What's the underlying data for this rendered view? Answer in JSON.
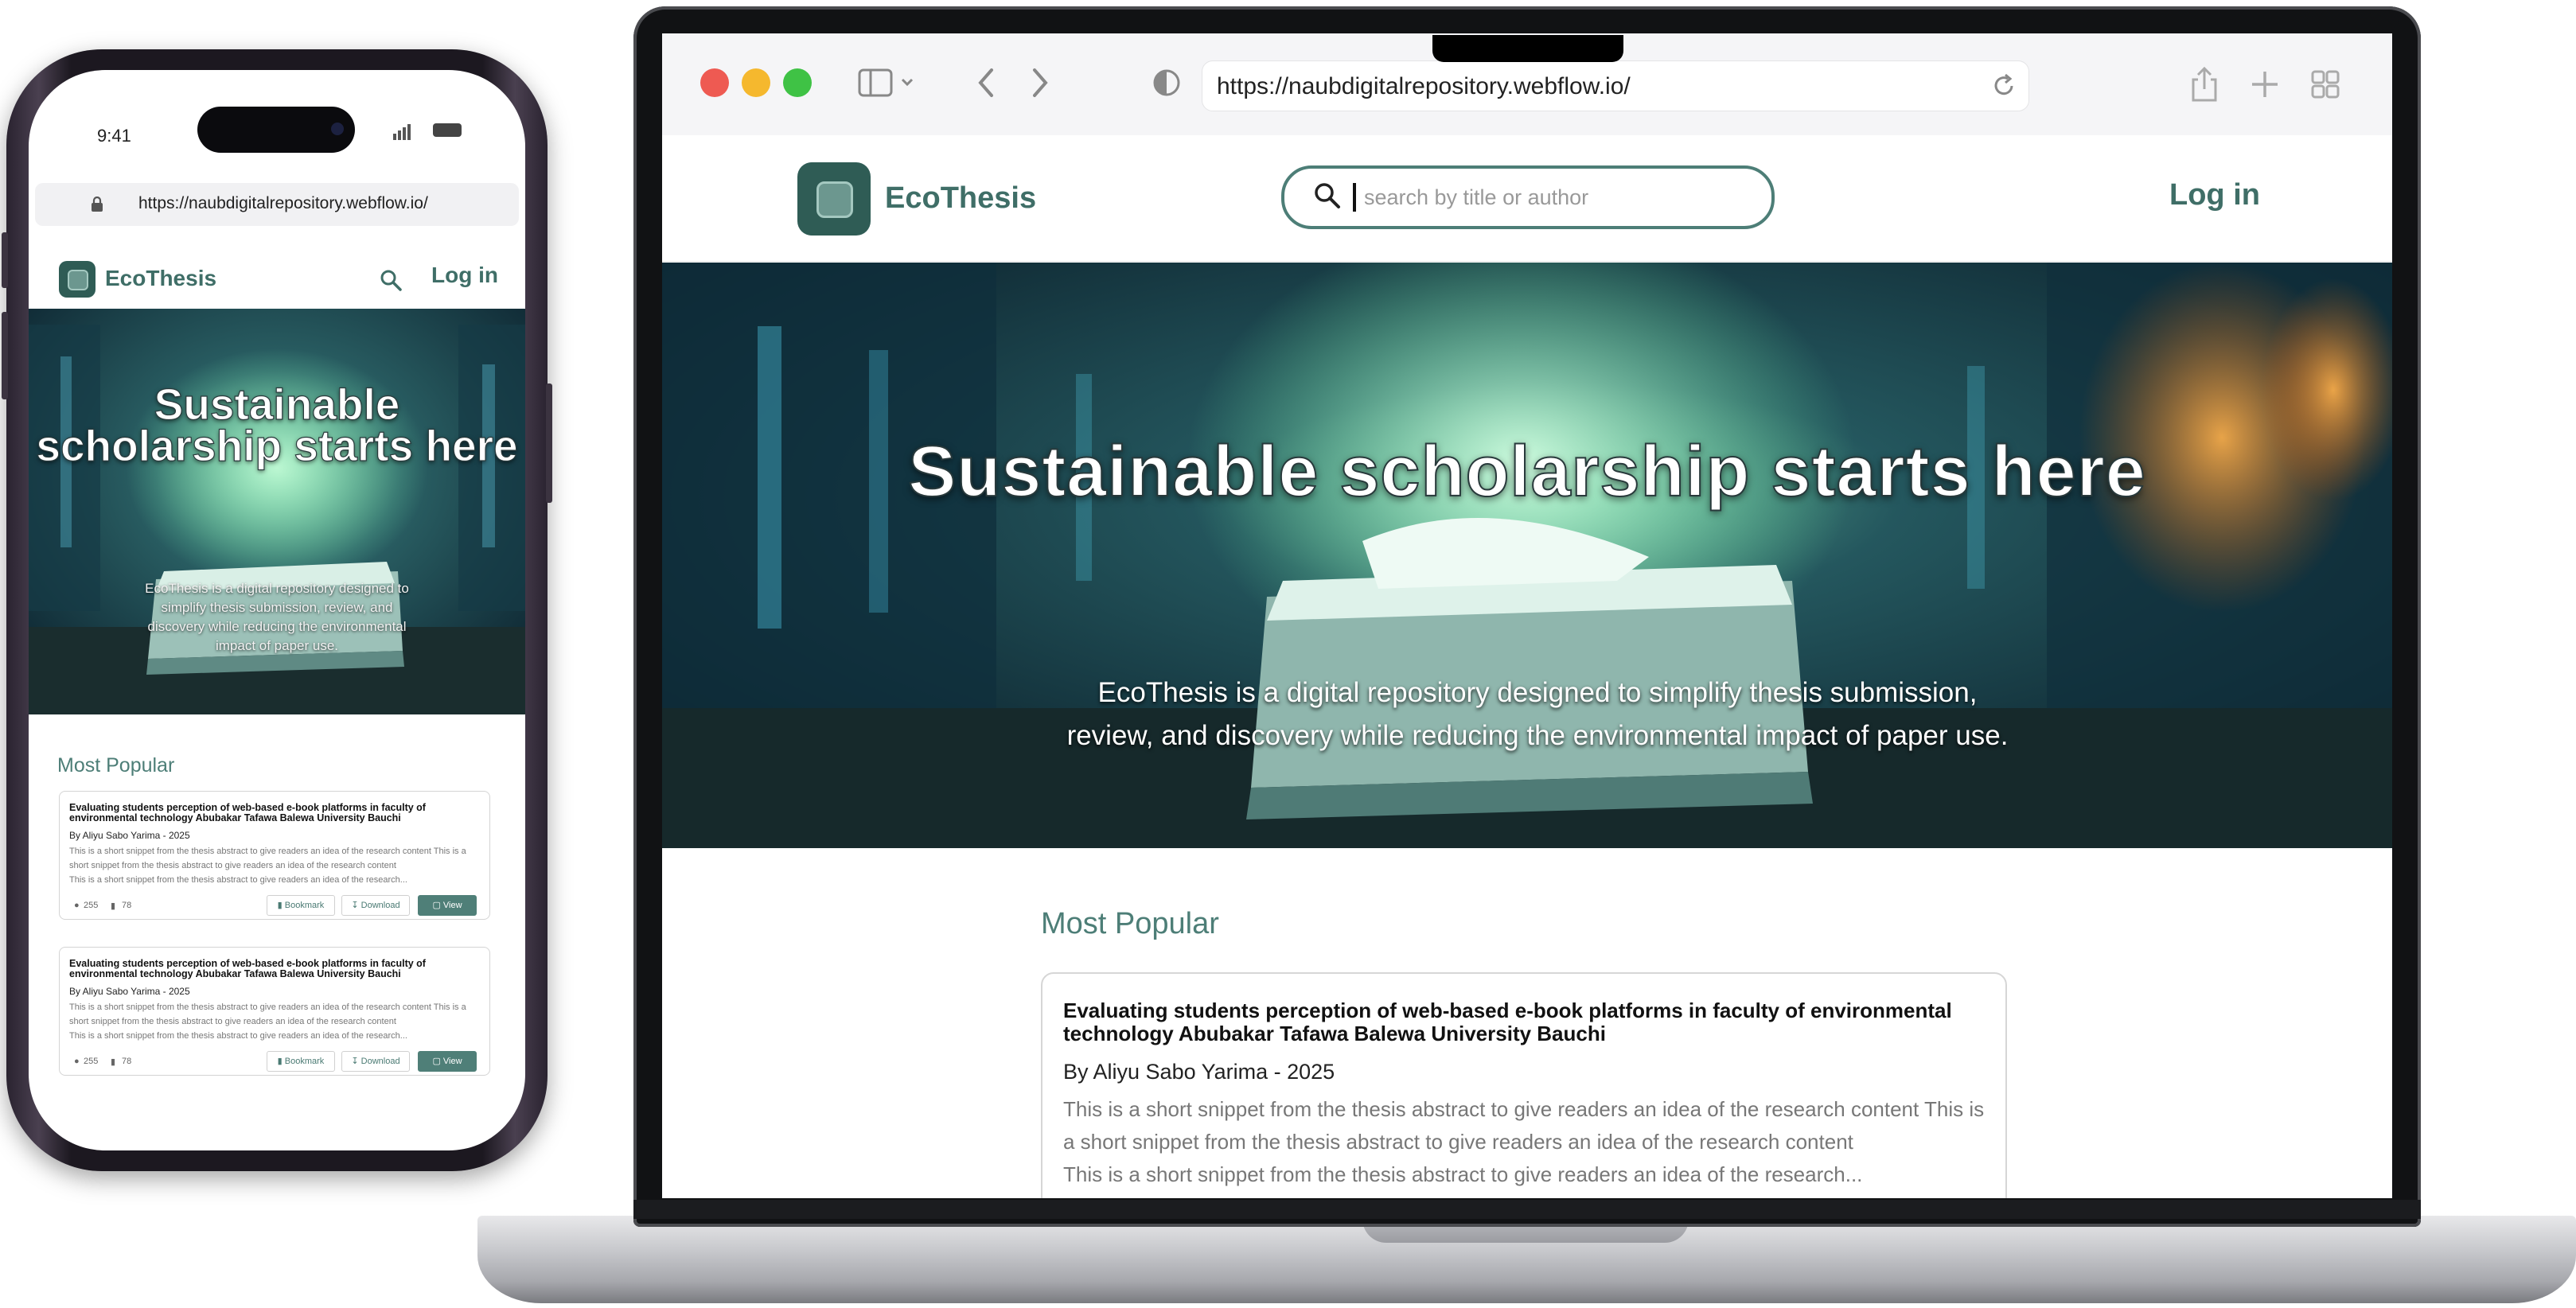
{
  "browser": {
    "url": "https://naubdigitalrepository.webflow.io/"
  },
  "phone": {
    "status_time": "9:41",
    "url": "https://naubdigitalrepository.webflow.io/"
  },
  "site": {
    "brand": "EcoThesis",
    "login_label": "Log in",
    "search_placeholder": "search by title or author",
    "hero_title": "Sustainable scholarship starts here",
    "hero_description": "EcoThesis is a digital repository designed to simplify thesis submission, review, and discovery while reducing the environmental impact of paper use.",
    "section_title": "Most Popular",
    "accent_color": "#4d7e77",
    "brand_color": "#2f5c55"
  },
  "theses": [
    {
      "title": "Evaluating students perception of web-based e-book platforms in faculty of environmental technology Abubakar Tafawa Balewa University Bauchi",
      "author_line": "By Aliyu Sabo Yarima  - 2025",
      "snippet": "This is a short snippet from the thesis abstract to give readers  an idea of the research content This is a short snippet from the thesis abstract to give readers  an idea of the research content",
      "snippet_2": "This is a short snippet from the thesis abstract to give readers an idea of the research...",
      "views": "255",
      "bookmarks": "78",
      "bookmark_label": "Bookmark",
      "download_label": "Download",
      "view_label": "View"
    },
    {
      "title": "Evaluating students perception of web-based e-book platforms in faculty of environmental technology Abubakar Tafawa Balewa University Bauchi",
      "author_line": "By Aliyu Sabo Yarima  - 2025",
      "snippet": "This is a short snippet from the thesis abstract to give readers  an idea of the research content This is a short snippet from the thesis abstract to give readers  an idea of the research content",
      "snippet_2": "This is a short snippet from the thesis abstract to give readers an idea of the research...",
      "views": "255",
      "bookmarks": "78",
      "bookmark_label": "Bookmark",
      "download_label": "Download",
      "view_label": "View"
    }
  ]
}
